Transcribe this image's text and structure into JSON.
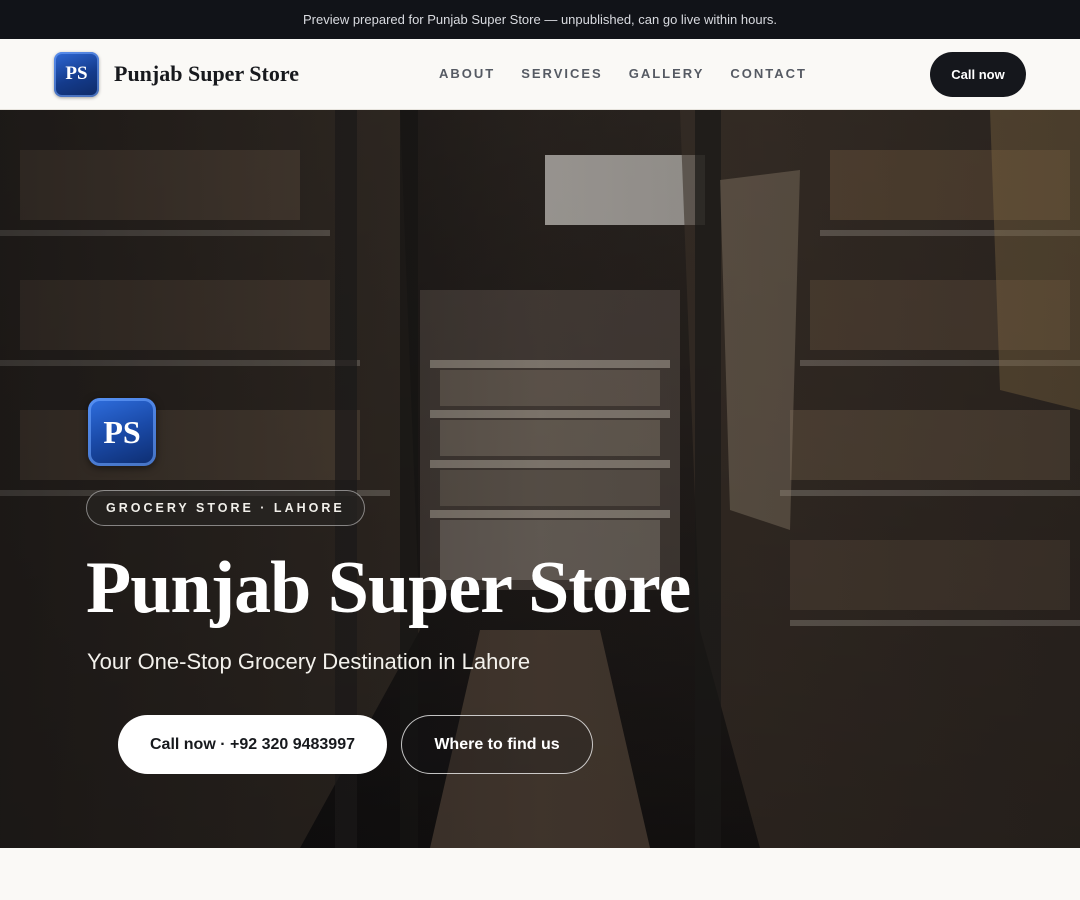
{
  "announcement": "Preview prepared for Punjab Super Store — unpublished, can go live within hours.",
  "header": {
    "logo_text": "PS",
    "brand_name": "Punjab Super Store",
    "nav": [
      "ABOUT",
      "SERVICES",
      "GALLERY",
      "CONTACT"
    ],
    "cta_label": "Call now"
  },
  "hero": {
    "logo_text": "PS",
    "tag": "GROCERY STORE · LAHORE",
    "title": "Punjab Super Store",
    "subtitle": "Your One-Stop Grocery Destination in Lahore",
    "primary_button": "Call now · +92 320 9483997",
    "secondary_button": "Where to find us"
  },
  "colors": {
    "topbar": "#111318",
    "header_bg": "#faf9f6",
    "logo_blue": "#1a4aa8",
    "dark_button": "#15171c"
  }
}
